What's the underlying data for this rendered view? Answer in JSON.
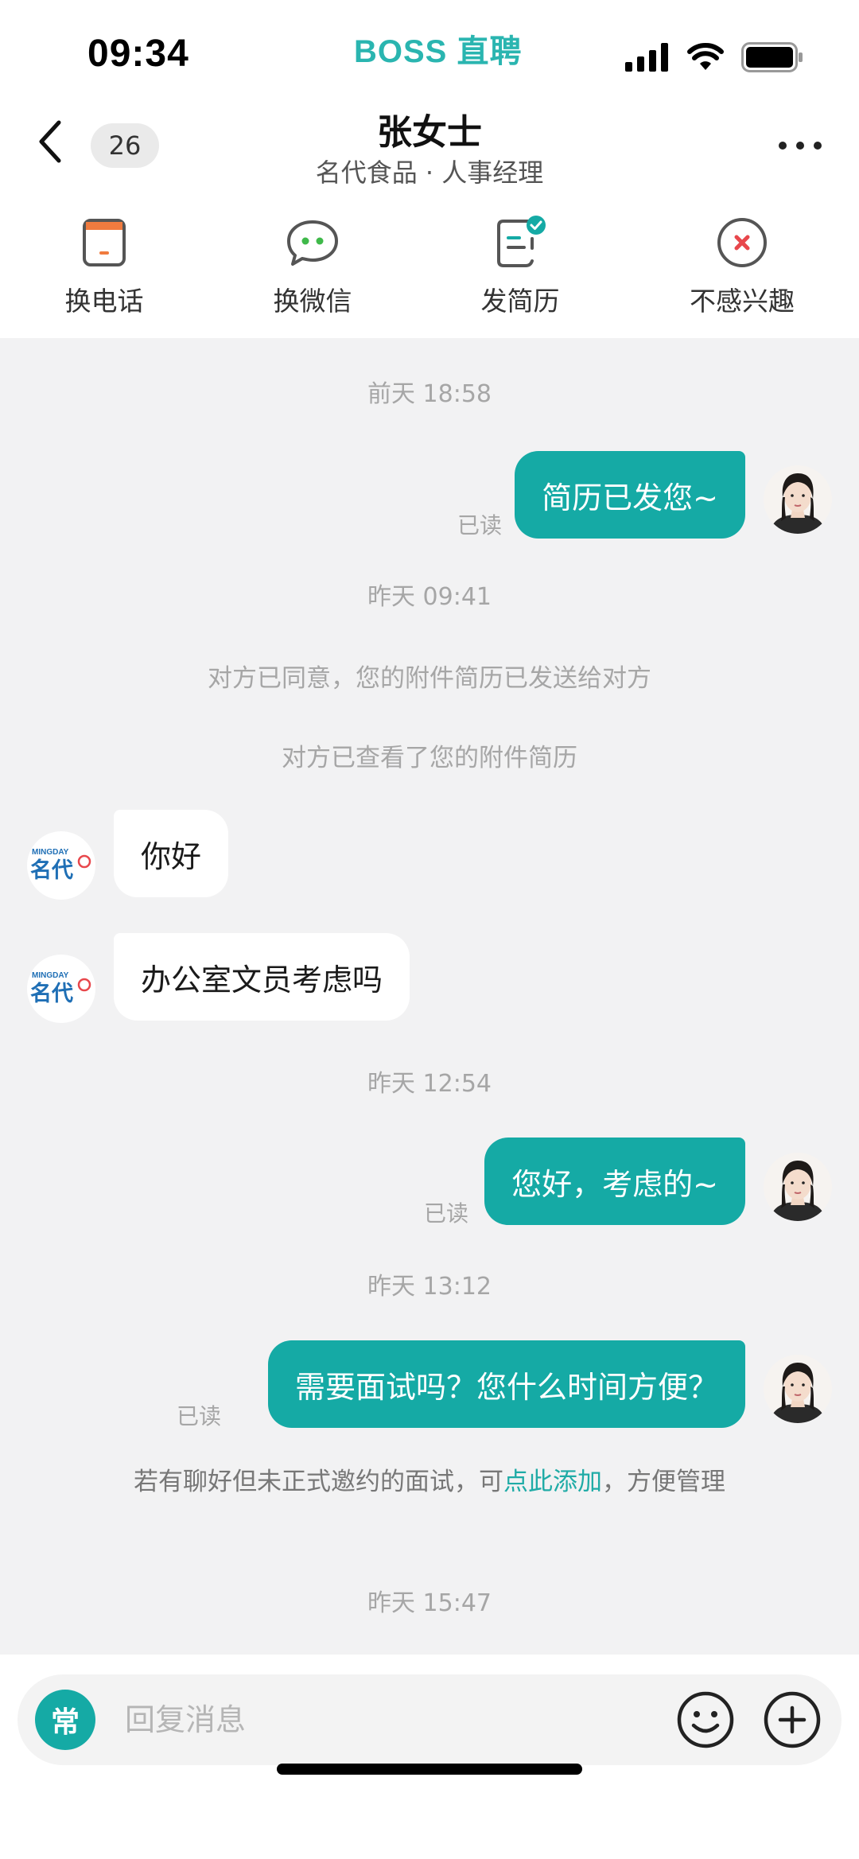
{
  "status_bar": {
    "time": "09:34",
    "app_logo": "BOSS 直聘",
    "icons": [
      "signal-icon",
      "wifi-icon",
      "battery-icon"
    ]
  },
  "header": {
    "unread_count": "26",
    "contact_name": "张女士",
    "contact_subtitle": "名代食品 · 人事经理"
  },
  "actions": [
    {
      "label": "换电话",
      "icon": "phone-swap-icon"
    },
    {
      "label": "换微信",
      "icon": "wechat-icon"
    },
    {
      "label": "发简历",
      "icon": "resume-icon"
    },
    {
      "label": "不感兴趣",
      "icon": "not-interested-icon"
    }
  ],
  "chat": {
    "ts1": "前天 18:58",
    "msg1": "简历已发您~",
    "msg1_status": "已读",
    "ts2": "昨天 09:41",
    "sys1": "对方已同意，您的附件简历已发送给对方",
    "sys2": "对方已查看了您的附件简历",
    "msg2": "你好",
    "msg3": "办公室文员考虑吗",
    "ts3": "昨天 12:54",
    "msg4": "您好，考虑的~",
    "msg4_status": "已读",
    "ts4": "昨天 13:12",
    "msg5": "需要面试吗？您什么时间方便？",
    "msg5_status": "已读",
    "sys3_before": "若有聊好但未正式邀约的面试，可",
    "sys3_link": "点此添加",
    "sys3_after": "，方便管理",
    "ts5": "昨天 15:47",
    "company_logo_top": "MINGDAY",
    "company_logo_main": "名代"
  },
  "input": {
    "quick_reply_label": "常",
    "placeholder": "回复消息",
    "value": ""
  },
  "colors": {
    "accent": "#15aaa5",
    "brand": "#2ab5b0",
    "danger": "#e8474c",
    "icon_orange": "#f07b3f"
  }
}
